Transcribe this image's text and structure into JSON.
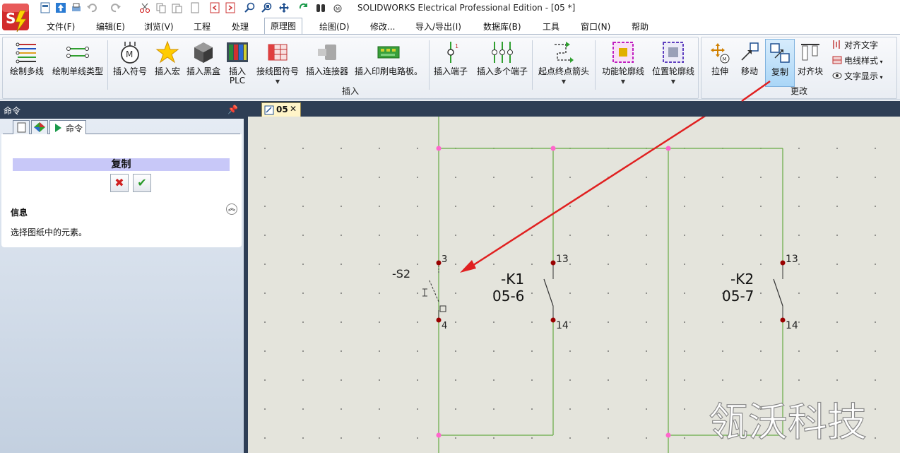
{
  "titlebar": {
    "title": "SOLIDWORKS Electrical Professional Edition - [05 *]",
    "logo_text": "SW"
  },
  "menu": {
    "tabs": [
      {
        "label": "文件(F)"
      },
      {
        "label": "编辑(E)"
      },
      {
        "label": "浏览(V)"
      },
      {
        "label": "工程"
      },
      {
        "label": "处理"
      },
      {
        "label": "原理图"
      },
      {
        "label": "绘图(D)"
      },
      {
        "label": "修改..."
      },
      {
        "label": "导入/导出(I)"
      },
      {
        "label": "数据库(B)"
      },
      {
        "label": "工具"
      },
      {
        "label": "窗口(N)"
      },
      {
        "label": "帮助"
      }
    ],
    "active": "原理图"
  },
  "ribbon": {
    "insert_group_label": "插入",
    "modify_group_label": "更改",
    "buttons": {
      "draw_multiwire": "绘制多线",
      "draw_single_wire_type": "绘制单线类型",
      "insert_symbol": "插入符号",
      "insert_macro": "插入宏",
      "insert_blackbox": "插入黑盒",
      "insert_plc": "插入\nPLC",
      "terminal_symbol": "接线图符号",
      "insert_connector": "插入连接器",
      "insert_pcb": "插入印刷电路板。",
      "insert_terminal": "插入端子",
      "insert_multi_terminal": "插入多个端子",
      "origin_dest_arrow": "起点终点箭头",
      "function_outline": "功能轮廓线",
      "location_outline": "位置轮廓线",
      "stretch": "拉伸",
      "move": "移动",
      "copy": "复制",
      "align_block": "对齐块",
      "align_text": "对齐文字",
      "wire_style": "电线样式",
      "text_display": "文字显示"
    }
  },
  "left_panel": {
    "title": "命令",
    "tab_command": "命令",
    "heading": "复制",
    "cancel_glyph": "✖",
    "ok_glyph": "✔",
    "info_title": "信息",
    "info_text": "选择图纸中的元素。"
  },
  "document": {
    "tab_label": "05",
    "close_glyph": "✕"
  },
  "drawing": {
    "s2_tag": "-S2",
    "s2_pin_top": "3",
    "s2_pin_bottom": "4",
    "k1_tag": "-K1",
    "k1_ref": "05-6",
    "k1_pin_top": "13",
    "k1_pin_bottom": "14",
    "k2_tag": "-K2",
    "k2_ref": "05-7",
    "k2_pin_top": "13",
    "k2_pin_bottom": "14",
    "watermark": "瓴沃科技"
  },
  "colors": {
    "canvas_bg": "#e4e4dc",
    "wire": "#66aa44",
    "node": "#ff66cc",
    "pin": "#990000",
    "arrow": "#e02020",
    "panel_header": "#2e3e55",
    "ribbon_pressed": "#aad6f7"
  },
  "icons": [
    "app-logo",
    "new-icon",
    "open-icon",
    "save-icon",
    "print-icon",
    "undo-icon",
    "redo-icon",
    "cut-icon",
    "copy-icon",
    "paste-icon",
    "zoom-icon",
    "pin-icon",
    "close-icon",
    "check-icon"
  ]
}
